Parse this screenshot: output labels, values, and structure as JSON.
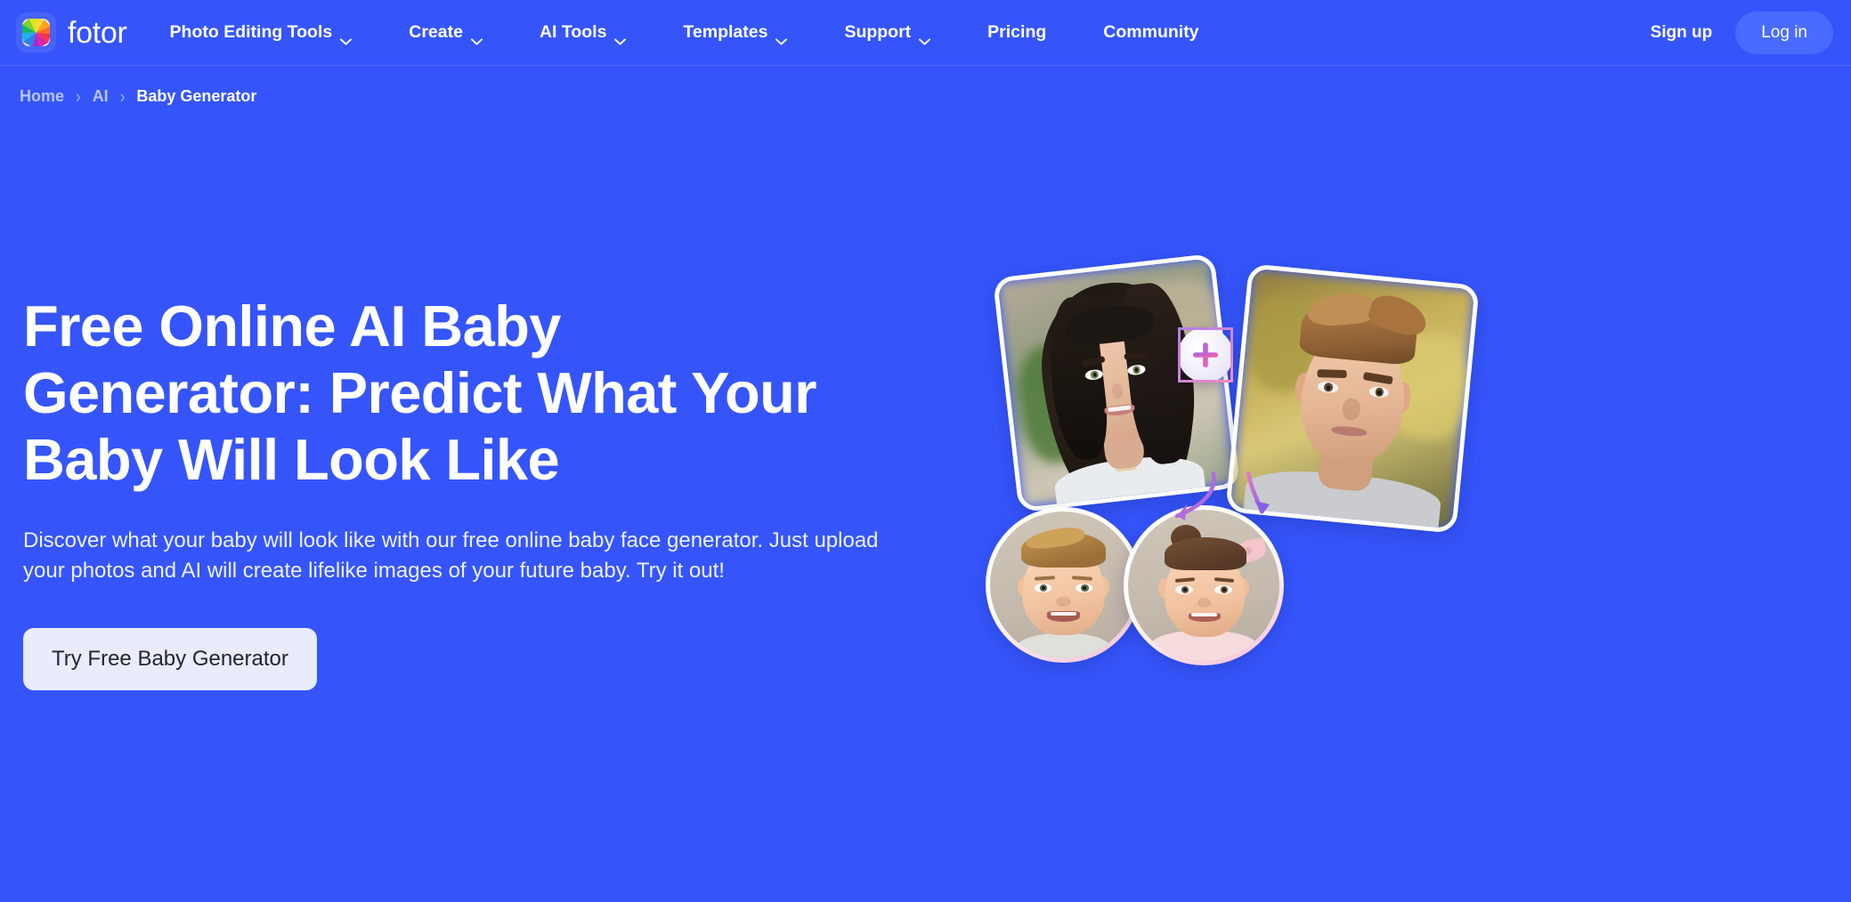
{
  "theme": {
    "bg_blue": "#3555FB",
    "nav_login_btn": "#4a6bff",
    "cta_bg": "#e8ecfd",
    "cta_text": "#23262e",
    "breadcrumb_muted": "#b9c5fb"
  },
  "nav": {
    "brand": "fotor",
    "brand_logo_icon": "color-wheel-icon",
    "items": [
      {
        "label": "Photo Editing Tools",
        "has_dropdown": true,
        "icon": "chevron-down-icon"
      },
      {
        "label": "Create",
        "has_dropdown": true,
        "icon": "chevron-down-icon"
      },
      {
        "label": "AI Tools",
        "has_dropdown": true,
        "icon": "chevron-down-icon"
      },
      {
        "label": "Templates",
        "has_dropdown": true,
        "icon": "chevron-down-icon"
      },
      {
        "label": "Support",
        "has_dropdown": true,
        "icon": "chevron-down-icon"
      },
      {
        "label": "Pricing",
        "has_dropdown": false,
        "icon": ""
      },
      {
        "label": "Community",
        "has_dropdown": false,
        "icon": ""
      }
    ],
    "sign_up": "Sign up",
    "log_in": "Log in"
  },
  "breadcrumb": {
    "separator": "›",
    "items": [
      {
        "label": "Home",
        "current": false
      },
      {
        "label": "AI",
        "current": false
      },
      {
        "label": "Baby Generator",
        "current": true
      }
    ]
  },
  "hero": {
    "title": "Free Online AI Baby Generator: Predict What Your Baby Will Look Like",
    "subtitle": "Discover what your baby will look like with our free online baby face generator. Just upload your photos and AI will create lifelike images of your future baby. Try it out!",
    "cta_label": "Try Free Baby Generator",
    "art": {
      "plus_icon": "plus-icon",
      "photos": [
        {
          "name": "mother-photo",
          "alt": "Young woman with long dark hair smiling"
        },
        {
          "name": "father-photo",
          "alt": "Young man with light brown hair"
        },
        {
          "name": "baby-boy-photo",
          "alt": "Generated baby boy smiling"
        },
        {
          "name": "baby-girl-photo",
          "alt": "Generated baby girl with pink bow"
        }
      ],
      "arrows": [
        "arrow-to-baby-boy",
        "arrow-to-baby-girl"
      ]
    }
  }
}
